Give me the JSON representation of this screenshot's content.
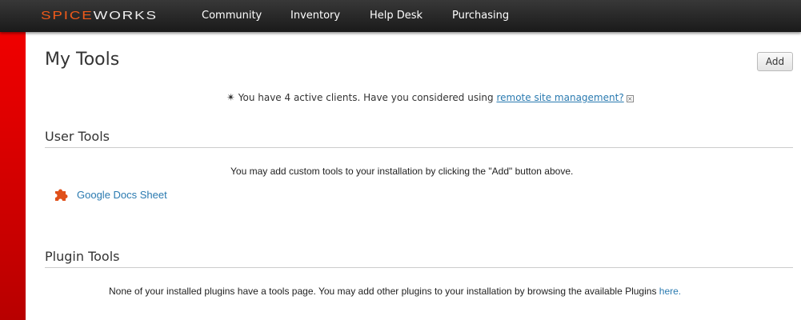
{
  "brand": {
    "logo_part1": "SPICE",
    "logo_part2": "WORKS"
  },
  "nav": [
    "Community",
    "Inventory",
    "Help Desk",
    "Purchasing"
  ],
  "page": {
    "title": "My Tools",
    "add_label": "Add"
  },
  "notice": {
    "text": "You have 4 active clients. Have you considered using ",
    "link": "remote site management?",
    "close": "×"
  },
  "user_tools": {
    "heading": "User Tools",
    "message": "You may add custom tools to your installation by clicking the \"Add\" button above.",
    "items": [
      {
        "label": "Google Docs Sheet"
      }
    ]
  },
  "plugin_tools": {
    "heading": "Plugin Tools",
    "message": "None of your installed plugins have a tools page. You may add other plugins to your installation by browsing the available Plugins ",
    "link": "here."
  }
}
